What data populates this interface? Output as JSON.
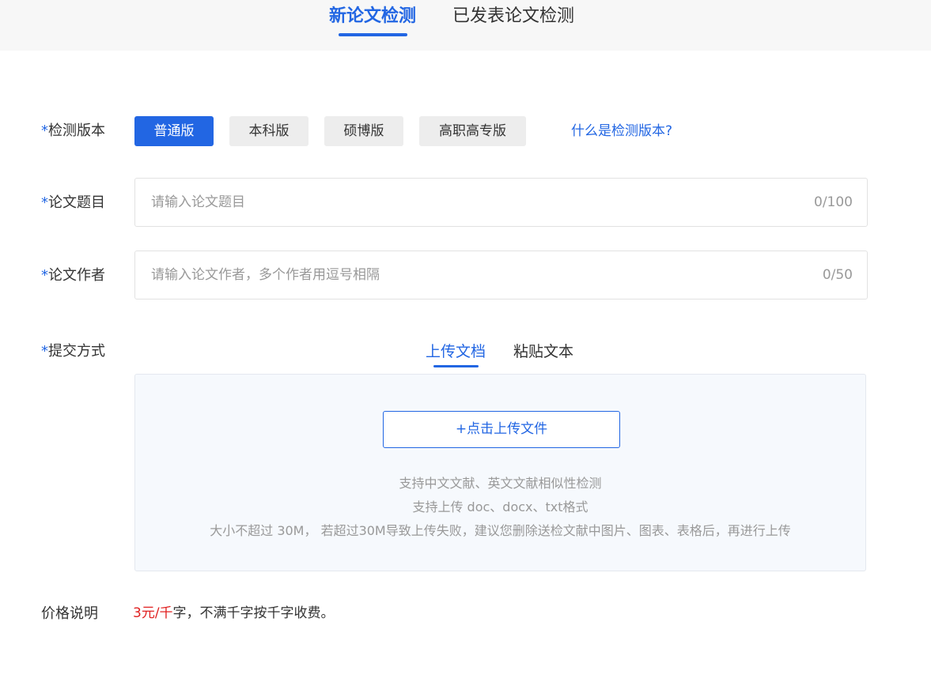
{
  "header": {
    "tabs": [
      {
        "label": "新论文检测",
        "active": true
      },
      {
        "label": "已发表论文检测",
        "active": false
      }
    ]
  },
  "form": {
    "version": {
      "required_mark": "*",
      "label": "检测版本",
      "options": [
        {
          "label": "普通版",
          "selected": true
        },
        {
          "label": "本科版",
          "selected": false
        },
        {
          "label": "硕博版",
          "selected": false
        },
        {
          "label": "高职高专版",
          "selected": false
        }
      ],
      "help_link": "什么是检测版本?"
    },
    "title": {
      "required_mark": "*",
      "label": "论文题目",
      "value": "",
      "placeholder": "请输入论文题目",
      "counter": "0/100"
    },
    "author": {
      "required_mark": "*",
      "label": "论文作者",
      "value": "",
      "placeholder": "请输入论文作者，多个作者用逗号相隔",
      "counter": "0/50"
    },
    "submit": {
      "required_mark": "*",
      "label": "提交方式",
      "tabs": [
        {
          "label": "上传文档",
          "active": true
        },
        {
          "label": "粘贴文本",
          "active": false
        }
      ],
      "upload_button": "+点击上传文件",
      "hints": [
        "支持中文文献、英文文献相似性检测",
        "支持上传 doc、docx、txt格式",
        "大小不超过 30M， 若超过30M导致上传失败，建议您删除送检文献中图片、图表、表格后，再进行上传"
      ]
    },
    "price": {
      "label": "价格说明",
      "highlight": "3元/千",
      "text": "字，不满千字按千字收费。"
    }
  },
  "colors": {
    "accent": "#2266e3",
    "price_red": "#e02020"
  }
}
